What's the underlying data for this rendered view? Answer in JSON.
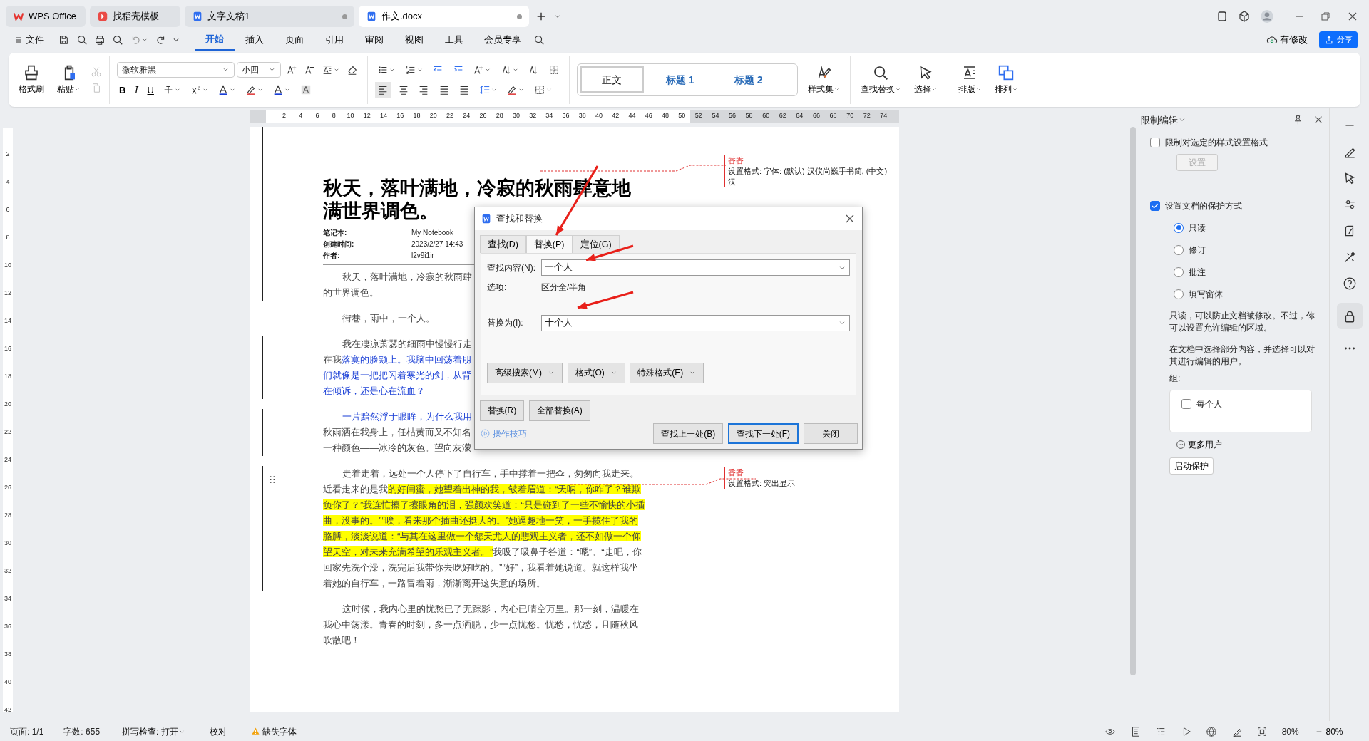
{
  "tabs": [
    {
      "label": "WPS Office",
      "kind": "home",
      "selected": false
    },
    {
      "label": "找稻壳模板",
      "kind": "template",
      "selected": false
    },
    {
      "label": "文字文稿1",
      "kind": "doc",
      "selected": false
    },
    {
      "label": "作文.docx",
      "kind": "doc",
      "selected": true
    }
  ],
  "menu": {
    "file": "文件",
    "items": [
      {
        "label": "开始",
        "selected": true
      },
      {
        "label": "插入",
        "selected": false
      },
      {
        "label": "页面",
        "selected": false
      },
      {
        "label": "引用",
        "selected": false
      },
      {
        "label": "审阅",
        "selected": false
      },
      {
        "label": "视图",
        "selected": false
      },
      {
        "label": "工具",
        "selected": false
      },
      {
        "label": "会员专享",
        "selected": false
      }
    ],
    "sync": "有修改",
    "share": "分享"
  },
  "ribbon": {
    "format_painter": "格式刷",
    "paste": "粘贴",
    "font": "微软雅黑",
    "size": "小四",
    "bold": "B",
    "italic": "I",
    "underline": "U",
    "styles": [
      {
        "label": "正文",
        "selected": true
      },
      {
        "label": "标题 1",
        "selected": false
      },
      {
        "label": "标题 2",
        "selected": false
      }
    ],
    "tools": [
      {
        "label": "样式集",
        "kind": "styles"
      },
      {
        "label": "查找替换",
        "kind": "find"
      },
      {
        "label": "选择",
        "kind": "select"
      },
      {
        "label": "排版",
        "kind": "layout"
      },
      {
        "label": "排列",
        "kind": "arrange"
      }
    ]
  },
  "ruler": {
    "ticks": [
      "2",
      "4",
      "6",
      "8",
      "10",
      "12",
      "14",
      "16",
      "18",
      "20",
      "22",
      "24",
      "26",
      "28",
      "30",
      "32",
      "34",
      "36",
      "38",
      "40",
      "42",
      "44",
      "46",
      "48",
      "50",
      "52",
      "54",
      "56",
      "58",
      "60",
      "62",
      "64",
      "66",
      "68",
      "70",
      "72",
      "74"
    ]
  },
  "vruler": {
    "ticks": [
      "2",
      "4",
      "6",
      "8",
      "10",
      "12",
      "14",
      "16",
      "18",
      "20",
      "22",
      "24",
      "26",
      "28",
      "30",
      "32",
      "34",
      "36",
      "38",
      "40",
      "42"
    ]
  },
  "document": {
    "title_lines": [
      "秋天，落叶满地，冷寂的秋雨肆意地",
      "满世界调色。"
    ],
    "meta": [
      {
        "label": "笔记本:",
        "value": "My Notebook"
      },
      {
        "label": "创建时间:",
        "value": "2023/2/27 14:43"
      },
      {
        "label": "作者:",
        "value": "l2v9i1ir"
      }
    ],
    "paragraphs": [
      {
        "revised": false,
        "lines": [
          [
            {
              "text": "秋天，落叶满地，冷寂的秋雨肆",
              "kind": "plain"
            }
          ],
          [
            {
              "text": "的世界调色。",
              "kind": "plain"
            }
          ]
        ]
      },
      {
        "revised": false,
        "lines": [
          [
            {
              "text": "街巷，雨中，一个人。",
              "kind": "plain"
            }
          ]
        ]
      },
      {
        "revised": true,
        "lines": [
          [
            {
              "text": "我在凄凉萧瑟的细雨中慢慢行走",
              "kind": "plain"
            }
          ],
          [
            {
              "text": "在我",
              "kind": "plain"
            },
            {
              "text": "落寞的脸颊上。我脑中回荡着朋",
              "kind": "inserted"
            }
          ],
          [
            {
              "text": "们就像是一把把闪着寒光的剑，从背",
              "kind": "inserted"
            }
          ],
          [
            {
              "text": "在倾诉，还是心在流血？",
              "kind": "inserted"
            }
          ]
        ]
      },
      {
        "revised": true,
        "lines": [
          [
            {
              "text": "一片黯然浮于眼眸，为什么我用",
              "kind": "inserted"
            }
          ],
          [
            {
              "text": "秋雨洒在我身上，任枯黄而又不知名",
              "kind": "plain"
            }
          ],
          [
            {
              "text": "一种颜色——冰冷的灰色。望向灰濛",
              "kind": "plain"
            }
          ]
        ]
      },
      {
        "revised": true,
        "lines": [
          [
            {
              "text": "走着走着，远处一个人停下了自行车，手中撑着一把伞，匆匆向我走来。",
              "kind": "plain"
            }
          ],
          [
            {
              "text": "近看走来的是我",
              "kind": "plain"
            },
            {
              "text": "的好闺蜜，她望着出神的我，皱着眉道：“天呐，你咋了？谁欺",
              "kind": "highlight"
            }
          ],
          [
            {
              "text": "负你了？”我连忙擦了擦眼角的泪，强颜欢笑道：“只是碰到了一些不愉快的小插",
              "kind": "highlight"
            }
          ],
          [
            {
              "text": "曲，没事的。”“唉，看来那个插曲还挺大的。”她逗趣地一笑，一手揽住了我的",
              "kind": "highlight"
            }
          ],
          [
            {
              "text": "胳膊，淡淡说道：“与其在这里做一个怨天尤人的悲观主义者，还不如做一个仰",
              "kind": "highlight"
            }
          ],
          [
            {
              "text": "望天空，对未来充满希望的乐观主义者。”",
              "kind": "highlight"
            },
            {
              "text": "我吸了吸鼻子答道：“嗯”。“走吧，你",
              "kind": "plain"
            }
          ],
          [
            {
              "text": "回家先洗个澡，洗完后我带你去吃好吃的。”“好”，我看着她说道。就这样我坐",
              "kind": "plain"
            }
          ],
          [
            {
              "text": "着她的自行车，一路冒着雨，渐渐离开这失意的场所。",
              "kind": "plain"
            }
          ]
        ]
      },
      {
        "revised": false,
        "lines": [
          [
            {
              "text": "这时候，我内心里的忧愁已了无踪影，内心已晴空万里。那一刻，温暖在",
              "kind": "plain"
            }
          ],
          [
            {
              "text": "我心中荡漾。青春的时刻，多一点洒脱，少一点忧愁。忧愁，忧愁，且随秋风",
              "kind": "plain"
            }
          ],
          [
            {
              "text": "吹散吧！",
              "kind": "plain"
            }
          ]
        ]
      }
    ]
  },
  "comments": [
    {
      "author": "香香",
      "text": "设置格式: 字体: (默认) 汉仪尚巍手书简, (中文) 汉"
    },
    {
      "author": "香香",
      "text": "设置格式: 突出显示"
    }
  ],
  "dialog": {
    "title": "查找和替换",
    "tabs": [
      {
        "label": "查找(D)",
        "selected": false
      },
      {
        "label": "替换(P)",
        "selected": true
      },
      {
        "label": "定位(G)",
        "selected": false
      }
    ],
    "find_label": "查找内容(N):",
    "find_value": "一个人",
    "options_label": "选项:",
    "options_value": "区分全/半角",
    "replace_label": "替换为(I):",
    "replace_value": "十个人",
    "option_buttons": [
      "高级搜索(M)",
      "格式(O)",
      "特殊格式(E)"
    ],
    "action_buttons": [
      "替换(R)",
      "全部替换(A)"
    ],
    "tips": "操作技巧",
    "footer_buttons": [
      {
        "label": "查找上一处(B)",
        "selected": false
      },
      {
        "label": "查找下一处(F)",
        "selected": true
      },
      {
        "label": "关闭",
        "selected": false
      }
    ]
  },
  "panel": {
    "title": "限制编辑",
    "format_check": {
      "label": "限制对选定的样式设置格式",
      "checked": false
    },
    "settings_button": {
      "label": "设置",
      "disabled": true
    },
    "protect_check": {
      "label": "设置文档的保护方式",
      "checked": true
    },
    "modes": [
      {
        "label": "只读",
        "selected": true
      },
      {
        "label": "修订",
        "selected": false
      },
      {
        "label": "批注",
        "selected": false
      },
      {
        "label": "填写窗体",
        "selected": false
      }
    ],
    "desc1": "只读，可以防止文档被修改。不过，你可以设置允许编辑的区域。",
    "desc2": "在文档中选择部分内容，并选择可以对其进行编辑的用户。",
    "group_label": "组:",
    "group_items": [
      {
        "label": "每个人",
        "checked": false
      }
    ],
    "more_users": "更多用户",
    "start_button": "启动保护"
  },
  "status_bar": {
    "page": "页面: 1/1",
    "words": "字数: 655",
    "spell": "拼写检查: 打开",
    "proof": "校对",
    "missing_font": "缺失字体",
    "zoom": "80%",
    "zoom_percent": "80%"
  }
}
